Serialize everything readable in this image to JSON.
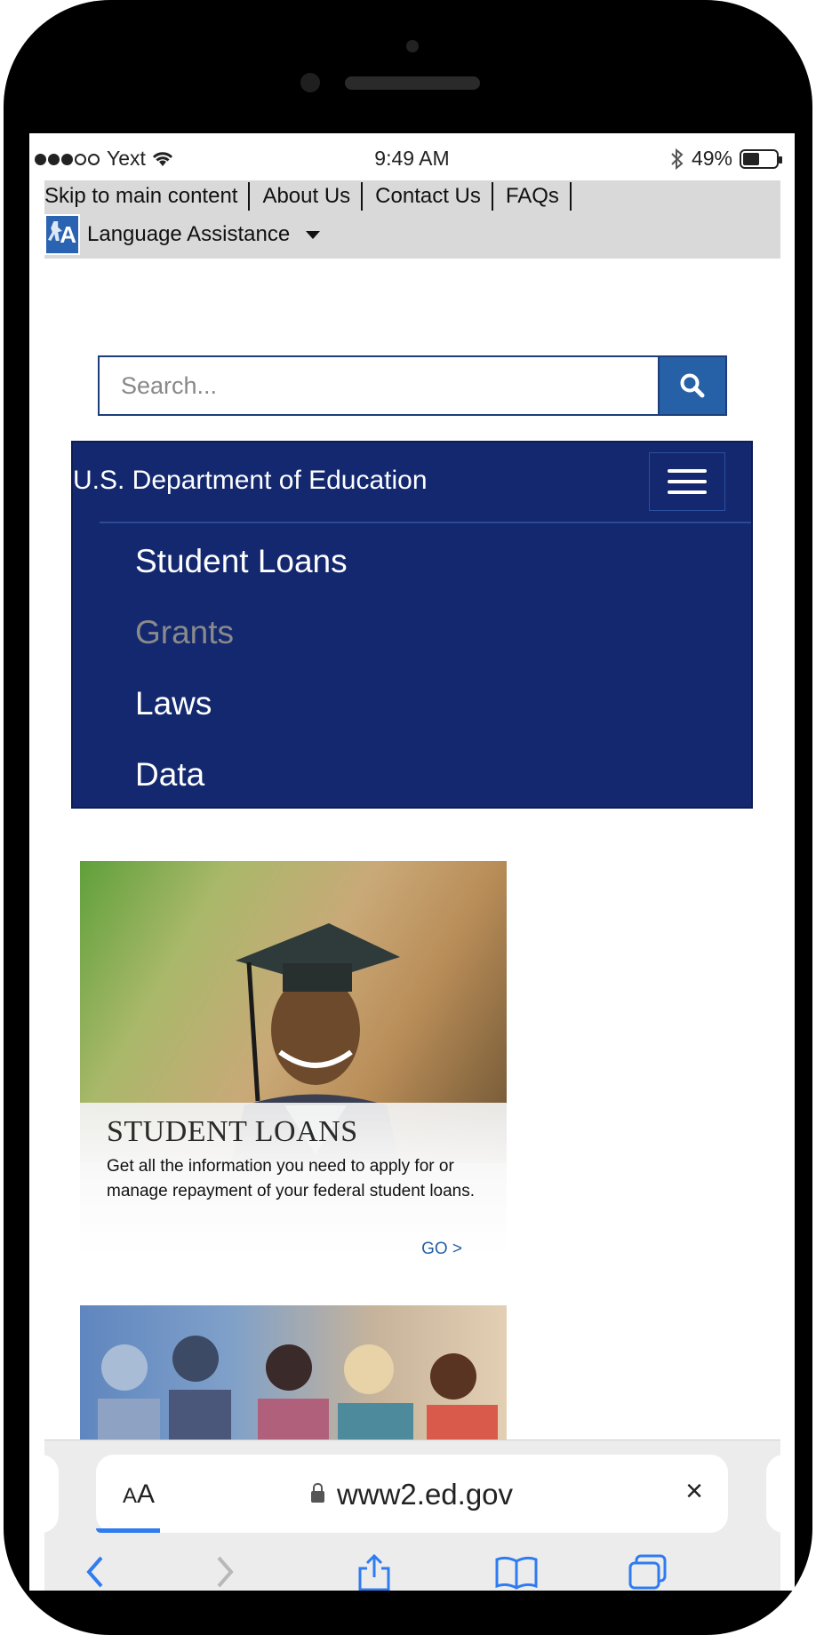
{
  "status_bar": {
    "carrier": "Yext",
    "time": "9:49 AM",
    "battery_percent": "49%",
    "battery_level": 0.49
  },
  "utility_nav": {
    "links": [
      "Skip to main content",
      "About Us",
      "Contact Us",
      "FAQs"
    ],
    "language_label": "Language Assistance"
  },
  "search": {
    "placeholder": "Search..."
  },
  "nav": {
    "title": "U.S. Department of Education",
    "items": [
      "Student Loans",
      "Grants",
      "Laws",
      "Data"
    ]
  },
  "card": {
    "title": "STUDENT LOANS",
    "text": "Get all the information you need to apply for or manage repayment of your federal student loans.",
    "link": "GO >"
  },
  "browser": {
    "aa_small": "A",
    "aa_large": "A",
    "url": "www2.ed.gov",
    "close": "×"
  },
  "colors": {
    "nav_bg": "#13286f",
    "search_button": "#2661a7",
    "link": "#2661a7",
    "ios_blue": "#2f7bf0"
  }
}
